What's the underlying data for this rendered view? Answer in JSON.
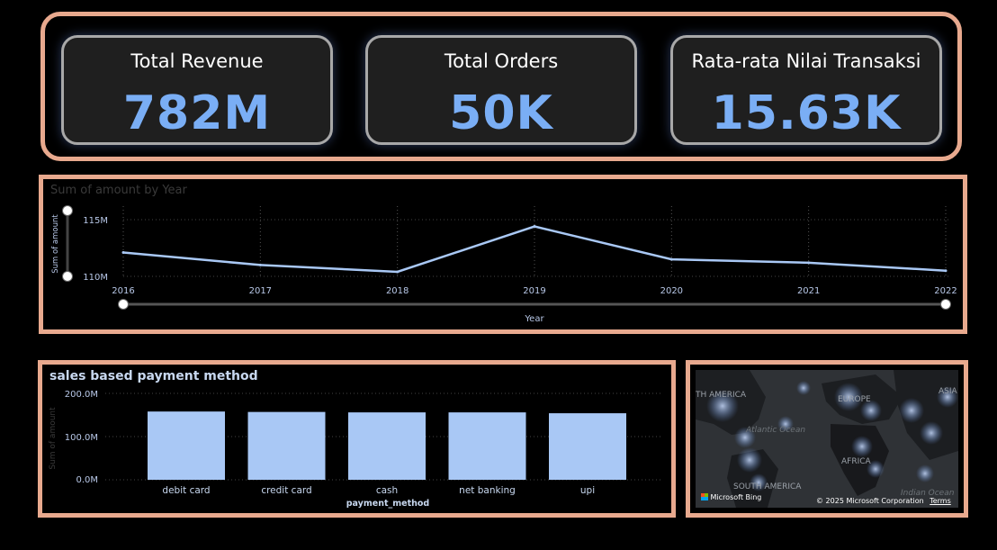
{
  "kpis": [
    {
      "title": "Total Revenue",
      "value": "782M"
    },
    {
      "title": "Total Orders",
      "value": "50K"
    },
    {
      "title": "Rata-rata Nilai Transaksi",
      "value": "15.63K"
    }
  ],
  "colors": {
    "panel_border": "#e8a98e",
    "kpi_value": "#7aaef5",
    "line": "#a9c8f5",
    "bar": "#a9c8f5",
    "background": "#000000"
  },
  "line_chart": {
    "title": "Sum of amount by Year",
    "xlabel": "Year",
    "ylabel": "Sum of amount",
    "ytick_labels": [
      "115M",
      "110M"
    ]
  },
  "bar_chart": {
    "title": "sales based payment method",
    "xlabel": "payment_method",
    "ylabel": "Sum of amount",
    "ytick_labels": [
      "200.0M",
      "100.0M",
      "0.0M"
    ]
  },
  "map": {
    "labels": [
      "TH AMERICA",
      "EUROPE",
      "ASIA",
      "AFRICA",
      "SOUTH AMERICA"
    ],
    "ocean_labels": [
      "Atlantic Ocean",
      "Indian Ocean"
    ],
    "attribution": "Microsoft Bing",
    "copyright": "© 2025 Microsoft Corporation",
    "terms": "Terms"
  },
  "chart_data": [
    {
      "type": "line",
      "title": "Sum of amount by Year",
      "xlabel": "Year",
      "ylabel": "Sum of amount",
      "x": [
        "2016",
        "2017",
        "2018",
        "2019",
        "2020",
        "2021",
        "2022"
      ],
      "series": [
        {
          "values": [
            112.1,
            111.0,
            110.4,
            114.4,
            111.5,
            111.2,
            110.5
          ]
        }
      ],
      "ylim": [
        110,
        115
      ],
      "yunit": "M",
      "grid": true
    },
    {
      "type": "bar",
      "title": "sales based payment method",
      "xlabel": "payment_method",
      "ylabel": "Sum of amount",
      "categories": [
        "debit card",
        "credit card",
        "cash",
        "net banking",
        "upi"
      ],
      "values": [
        158,
        157,
        156,
        156,
        154
      ],
      "ylim": [
        0,
        200
      ],
      "yunit": "M",
      "grid": true
    }
  ]
}
